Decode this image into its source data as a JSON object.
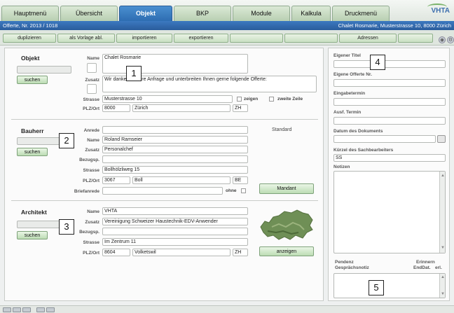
{
  "tabs": [
    {
      "label": "Hauptmenü",
      "active": false
    },
    {
      "label": "Übersicht",
      "active": false
    },
    {
      "label": "Objekt",
      "active": true
    },
    {
      "label": "BKP",
      "active": false
    },
    {
      "label": "Module",
      "active": false
    },
    {
      "label": "Kalkula",
      "active": false
    },
    {
      "label": "Druckmenü",
      "active": false
    }
  ],
  "brand": "VHTA",
  "header": {
    "left": "Offerte, Nr. 2013 / 1018",
    "right": "Chalet Rosmarie, Musterstrasse 10, 8000 Zürich"
  },
  "actions": [
    "duplizieren",
    "als Vorlage abl.",
    "importieren",
    "exportieren",
    "",
    "",
    "Adressen",
    ""
  ],
  "objekt": {
    "title": "Objekt",
    "search": "suchen",
    "name_label": "Name",
    "name": "Chalet Rosmarie",
    "zusatz_label": "Zusatz",
    "zusatz": "Wir danken für Ihre Anfrage und unterbreiten Ihnen gerne folgende Offerte:",
    "strasse_label": "Strasse",
    "strasse": "Musterstrasse 10",
    "zeigen": "zeigen",
    "zweite_zeile": "zweite Zeile",
    "plzort_label": "PLZ/Ort",
    "plz": "8000",
    "ort": "Zürich",
    "kanton": "ZH"
  },
  "bauherr": {
    "title": "Bauherr",
    "search": "suchen",
    "anrede_label": "Anrede",
    "anrede": "",
    "standard": "Standard",
    "name_label": "Name",
    "name": "Roland Ramseier",
    "zusatz_label": "Zusatz",
    "zusatz": "Personalchef",
    "bezugsp_label": "Bezugsp.",
    "bezugsp": "",
    "strasse_label": "Strasse",
    "strasse": "Bollhölzliweg 15",
    "plzort_label": "PLZ/Ort",
    "plz": "3067",
    "ort": "Boll",
    "kanton": "BE",
    "briefanrede_label": "Briefanrede",
    "briefanrede": "",
    "ohne": "ohne",
    "mandant": "Mandant"
  },
  "architekt": {
    "title": "Architekt",
    "search": "suchen",
    "name_label": "Name",
    "name": "VHTA",
    "zusatz_label": "Zusatz",
    "zusatz": "Vereinigung Schweizer Haustechnik-EDV-Anwender",
    "bezugsp_label": "Bezugsp.",
    "bezugsp": "",
    "strasse_label": "Strasse",
    "strasse": "Im Zentrum 11",
    "plzort_label": "PLZ/Ort",
    "plz": "8604",
    "ort": "Volketswil",
    "kanton": "ZH",
    "anzeigen": "anzeigen"
  },
  "right": {
    "eigener_titel": "Eigener Titel",
    "eigene_offerte_nr": "Eigene Offerte Nr.",
    "eingabetermin": "Eingabetermin",
    "ausf_termin": "Ausf. Termin",
    "datum_dokument": "Datum des Dokuments",
    "kuerzel_label": "Kürzel des Sachbearbeiters",
    "kuerzel": "SS",
    "notizen": "Notizen",
    "pendenz": "Pendenz",
    "gespraechsnotiz": "Gesprächsnotiz",
    "erinnern": "Erinnern",
    "enddat": "EndDat.",
    "erl": "erl."
  },
  "callouts": [
    "1",
    "2",
    "3",
    "4",
    "5"
  ]
}
